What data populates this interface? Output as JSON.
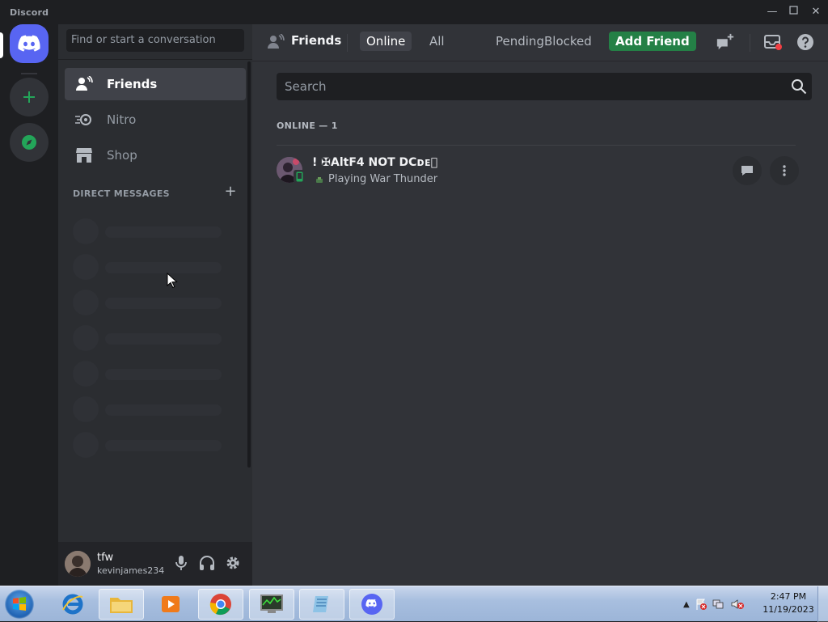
{
  "window": {
    "app_name": "Discord",
    "controls": [
      "minimize",
      "maximize",
      "close"
    ]
  },
  "servers": {
    "items": [
      {
        "name": "home",
        "icon": "discord-logo-icon"
      },
      {
        "name": "add-server",
        "icon": "plus-icon"
      },
      {
        "name": "explore",
        "icon": "compass-icon"
      }
    ]
  },
  "sidebar": {
    "search_placeholder": "Find or start a conversation",
    "nav": [
      {
        "label": "Friends",
        "icon": "friends-wave-icon",
        "active": true
      },
      {
        "label": "Nitro",
        "icon": "nitro-icon",
        "active": false
      },
      {
        "label": "Shop",
        "icon": "shop-icon",
        "active": false
      }
    ],
    "dm_header": "DIRECT MESSAGES",
    "dm_add": "+"
  },
  "user": {
    "name": "tfw",
    "tag": "kevinjames234",
    "controls": [
      "mic-icon",
      "headphones-icon",
      "gear-icon"
    ]
  },
  "header": {
    "title": "Friends",
    "tabs": [
      {
        "label": "Online",
        "active": true
      },
      {
        "label": "All",
        "active": false
      },
      {
        "label": "Pending",
        "active": false
      },
      {
        "label": "Blocked",
        "active": false
      }
    ],
    "add_friend": "Add Friend",
    "icons": [
      "new-group-dm-icon",
      "inbox-icon",
      "help-icon"
    ]
  },
  "friends": {
    "search_placeholder": "Search",
    "online_header": "ONLINE — 1",
    "list": [
      {
        "name": "! ✠AltF4 NOT DCᴅᴇ⃠",
        "status": "Playing War Thunder",
        "device": "mobile"
      }
    ]
  },
  "taskbar": {
    "time": "2:47 PM",
    "date": "11/19/2023",
    "apps": [
      "internet-explorer",
      "file-explorer",
      "media-player",
      "chrome",
      "task-manager",
      "notepad",
      "discord"
    ]
  },
  "colors": {
    "blurple": "#5865f2",
    "green": "#248046",
    "bg_main": "#313338",
    "bg_side": "#2b2d31",
    "bg_servers": "#1e1f22"
  }
}
